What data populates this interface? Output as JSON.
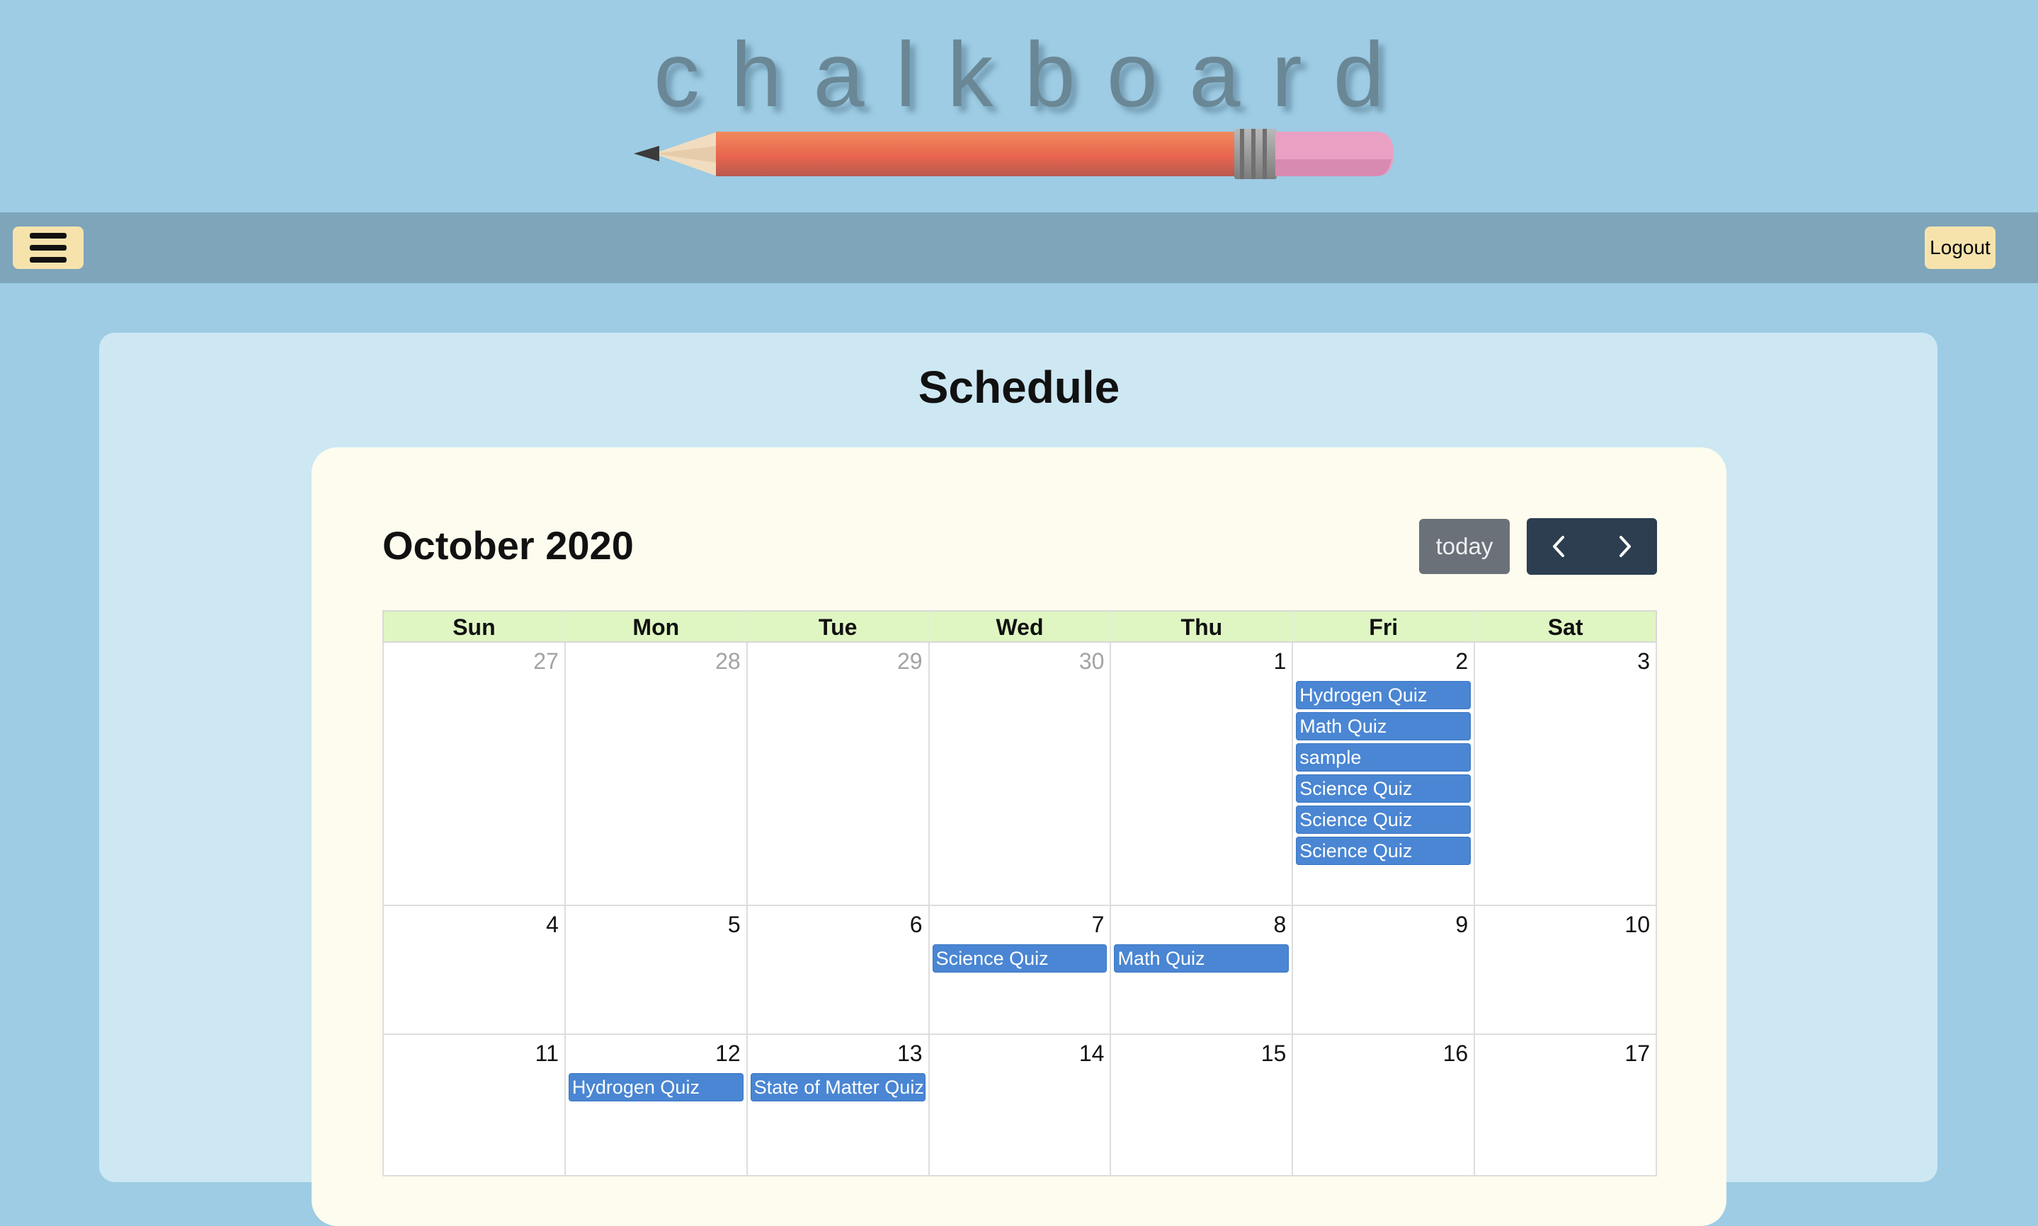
{
  "site": {
    "logo_text": "chalkboard",
    "pencil_icon": "pencil-icon"
  },
  "navbar": {
    "menu_icon": "hamburger-menu-icon",
    "logout_label": "Logout"
  },
  "page": {
    "title": "Schedule"
  },
  "calendar": {
    "title": "October 2020",
    "today_label": "today",
    "prev_icon": "chevron-left-icon",
    "next_icon": "chevron-right-icon",
    "day_names": [
      "Sun",
      "Mon",
      "Tue",
      "Wed",
      "Thu",
      "Fri",
      "Sat"
    ],
    "weeks": [
      {
        "days": [
          {
            "num": "27",
            "other": true,
            "events": []
          },
          {
            "num": "28",
            "other": true,
            "events": []
          },
          {
            "num": "29",
            "other": true,
            "events": []
          },
          {
            "num": "30",
            "other": true,
            "events": []
          },
          {
            "num": "1",
            "other": false,
            "events": []
          },
          {
            "num": "2",
            "other": false,
            "events": [
              "Hydrogen Quiz",
              "Math Quiz",
              "sample",
              "Science Quiz",
              "Science Quiz",
              "Science Quiz"
            ]
          },
          {
            "num": "3",
            "other": false,
            "events": []
          }
        ]
      },
      {
        "days": [
          {
            "num": "4",
            "other": false,
            "events": []
          },
          {
            "num": "5",
            "other": false,
            "events": []
          },
          {
            "num": "6",
            "other": false,
            "events": []
          },
          {
            "num": "7",
            "other": false,
            "events": [
              "Science Quiz"
            ]
          },
          {
            "num": "8",
            "other": false,
            "events": [
              "Math Quiz"
            ]
          },
          {
            "num": "9",
            "other": false,
            "events": []
          },
          {
            "num": "10",
            "other": false,
            "events": []
          }
        ]
      },
      {
        "days": [
          {
            "num": "11",
            "other": false,
            "events": []
          },
          {
            "num": "12",
            "other": false,
            "events": [
              "Hydrogen Quiz"
            ]
          },
          {
            "num": "13",
            "other": false,
            "events": [
              "State of Matter Quiz"
            ]
          },
          {
            "num": "14",
            "other": false,
            "events": []
          },
          {
            "num": "15",
            "other": false,
            "events": []
          },
          {
            "num": "16",
            "other": false,
            "events": []
          },
          {
            "num": "17",
            "other": false,
            "events": []
          }
        ]
      }
    ]
  },
  "colors": {
    "background": "#9dcce4",
    "navbar": "#7ea5ba",
    "button_yellow": "#f6e3ac",
    "event_blue": "#4a86d3",
    "header_row": "#dff6c2",
    "nav_dark": "#2c3e50"
  }
}
